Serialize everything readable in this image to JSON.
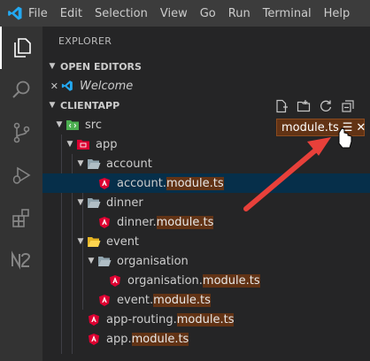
{
  "menu": [
    "File",
    "Edit",
    "Selection",
    "View",
    "Go",
    "Run",
    "Terminal",
    "Help"
  ],
  "sidebar": {
    "title": "EXPLORER",
    "open_editors": {
      "label": "OPEN EDITORS",
      "items": [
        {
          "name": "Welcome"
        }
      ]
    },
    "workspace": {
      "label": "CLIENTAPP"
    }
  },
  "tree": {
    "src": "src",
    "app": "app",
    "account": "account",
    "account_file_prefix": "account.",
    "account_file_match": "module.ts",
    "dinner": "dinner",
    "dinner_file_prefix": "dinner.",
    "dinner_file_match": "module.ts",
    "event": "event",
    "organisation": "organisation",
    "organisation_file_prefix": "organisation.",
    "organisation_file_match": "module.ts",
    "event_file_prefix": "event.",
    "event_file_match": "module.ts",
    "routing_file_prefix": "app-routing.",
    "routing_file_match": "module.ts",
    "app_file_prefix": "app.",
    "app_file_match": "module.ts"
  },
  "find_widget": {
    "query": "module.ts",
    "filter_glyph": "☰",
    "close_glyph": "✕"
  },
  "icons": {
    "activity": [
      "files-icon",
      "search-icon",
      "source-control-icon",
      "run-debug-icon",
      "extensions-icon",
      "nx-console-icon"
    ],
    "toolbar": [
      "new-file-icon",
      "new-folder-icon",
      "refresh-icon",
      "collapse-all-icon"
    ]
  },
  "colors": {
    "highlight": "#623315",
    "angular_red": "#dd0031",
    "arrow": "#e8403a",
    "selection": "#062f4a"
  }
}
